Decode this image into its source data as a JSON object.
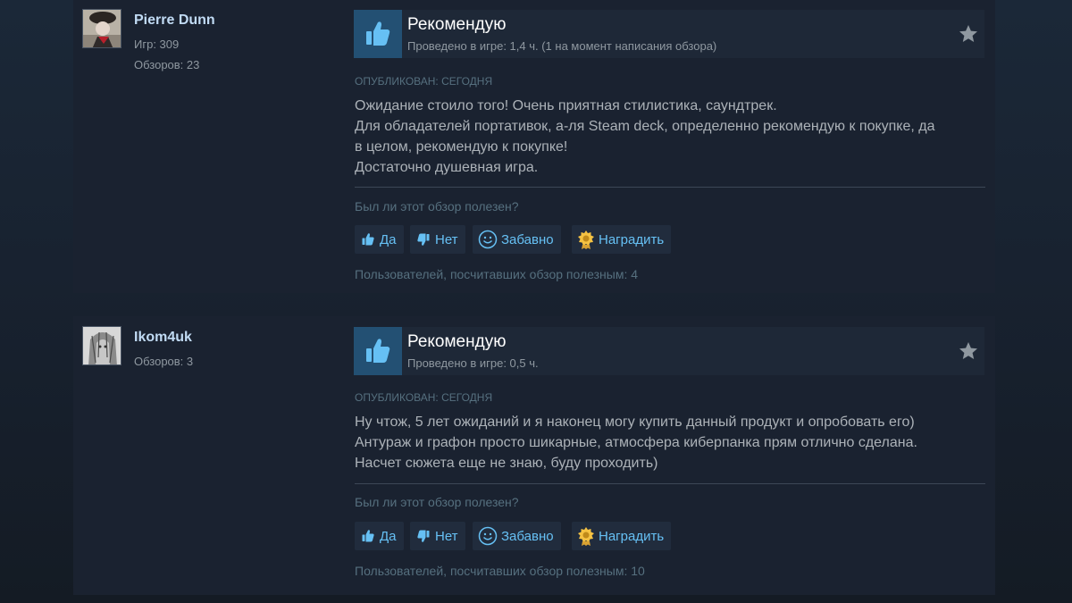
{
  "reviews": [
    {
      "author": {
        "name": "Pierre Dunn",
        "stats": [
          "Игр: 309",
          "Обзоров: 23"
        ]
      },
      "recommendation": "Рекомендую",
      "playtime": "Проведено в игре: 1,4 ч. (1 на момент написания обзора)",
      "posted": "Опубликован: сегодня",
      "body": [
        "Ожидание стоило того! Очень приятная стилистика, саундтрек.",
        "Для обладателей портативок, а-ля Steam deck, определенно рекомендую к покупке, да",
        "в целом, рекомендую к покупке!",
        "Достаточно душевная игра."
      ],
      "helpful_question": "Был ли этот обзор полезен?",
      "buttons": {
        "yes": "Да",
        "no": "Нет",
        "funny": "Забавно",
        "award": "Наградить"
      },
      "helpful_count": "Пользователей, посчитавших обзор полезным: 4"
    },
    {
      "author": {
        "name": "Ikom4uk",
        "stats": [
          "Обзоров: 3"
        ]
      },
      "recommendation": "Рекомендую",
      "playtime": "Проведено в игре: 0,5 ч.",
      "posted": "Опубликован: сегодня",
      "body": [
        "Ну чтож, 5 лет ожиданий и я наконец могу купить данный продукт и опробовать его)",
        "Антураж и графон просто шикарные, атмосфера киберпанка прям отлично сделана.",
        "Насчет сюжета еще не знаю, буду проходить)"
      ],
      "helpful_question": "Был ли этот обзор полезен?",
      "buttons": {
        "yes": "Да",
        "no": "Нет",
        "funny": "Забавно",
        "award": "Наградить"
      },
      "helpful_count": "Пользователей, посчитавших обзор полезным: 10"
    }
  ],
  "icons": {
    "recommend": "thumbs-up-icon",
    "award_star": "star-icon",
    "yes": "thumbs-up-icon",
    "no": "thumbs-down-icon",
    "funny": "smiley-icon",
    "award": "award-medal-icon"
  },
  "colors": {
    "background": "#1b2838",
    "card": "#1a2230",
    "accent_link": "#66c0f4",
    "thumb_box": "#235073",
    "title": "#ffffff",
    "body_text": "#acb2b8",
    "muted": "#56707f"
  }
}
